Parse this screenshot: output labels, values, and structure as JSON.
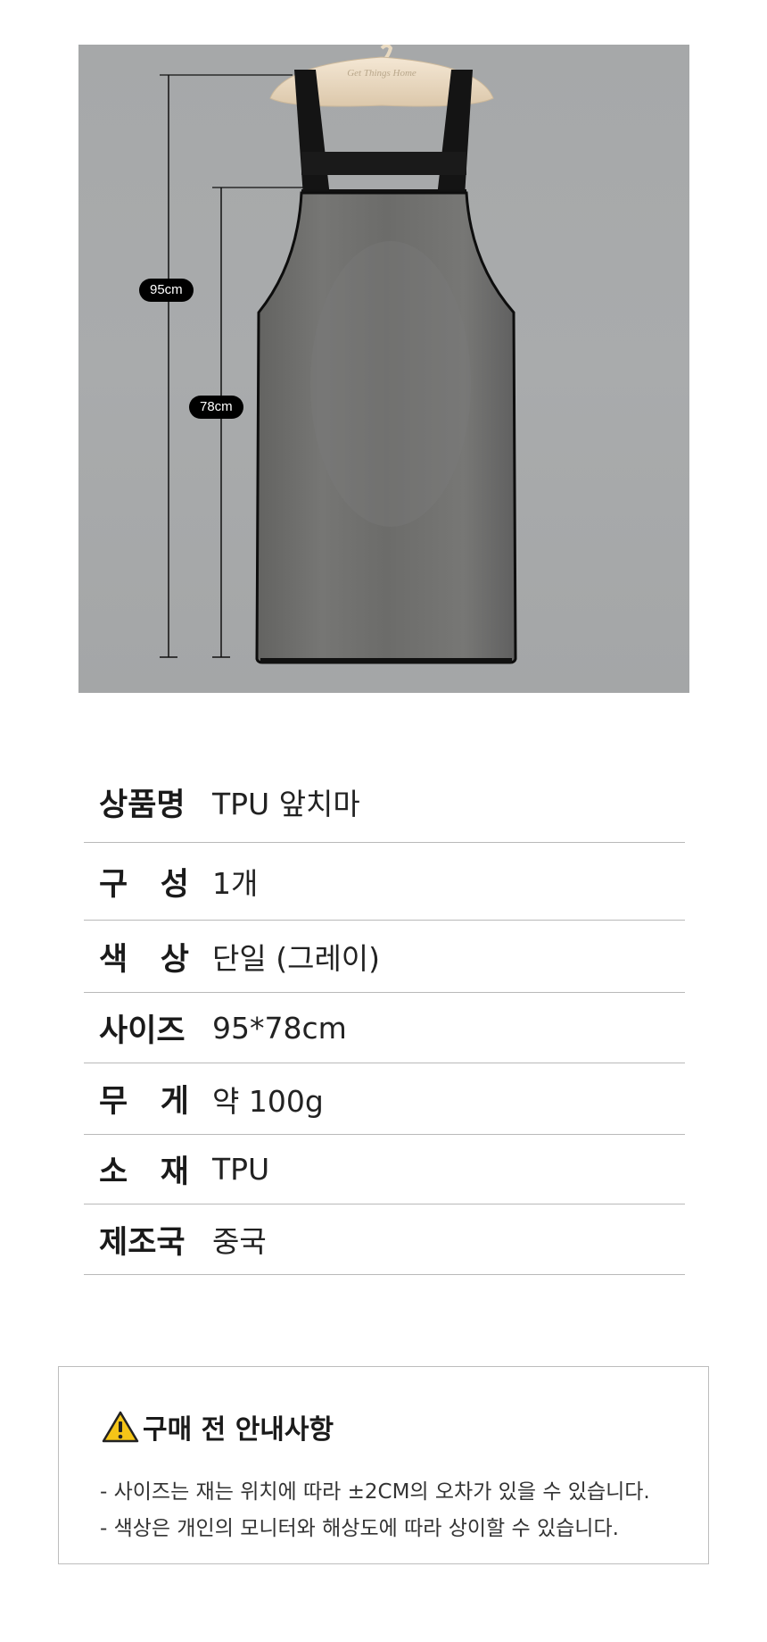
{
  "product_image": {
    "dimension_total": "95cm",
    "dimension_body": "78cm",
    "hanger_text": "Get Things Home"
  },
  "specs": [
    {
      "label": "상품명",
      "value": "TPU 앞치마"
    },
    {
      "label": "구   성",
      "value": "1개"
    },
    {
      "label": "색   상",
      "value": "단일 (그레이)"
    },
    {
      "label": "사이즈",
      "value": "95*78cm"
    },
    {
      "label": "무   게",
      "value": "약 100g"
    },
    {
      "label": "소   재",
      "value": "TPU"
    },
    {
      "label": "제조국",
      "value": "중국"
    }
  ],
  "notice": {
    "icon": "warning-icon",
    "title": "구매 전 안내사항",
    "lines": [
      "- 사이즈는 재는 위치에 따라 ±2CM의 오차가 있을 수 있습니다.",
      "- 색상은 개인의 모니터와 해상도에 따라 상이할 수 있습니다."
    ]
  },
  "colors": {
    "wall": "#a8aaab",
    "apron": "#6f6f6d",
    "strap": "#141414",
    "hanger": "#eedfc9",
    "warning": "#f5c518"
  }
}
